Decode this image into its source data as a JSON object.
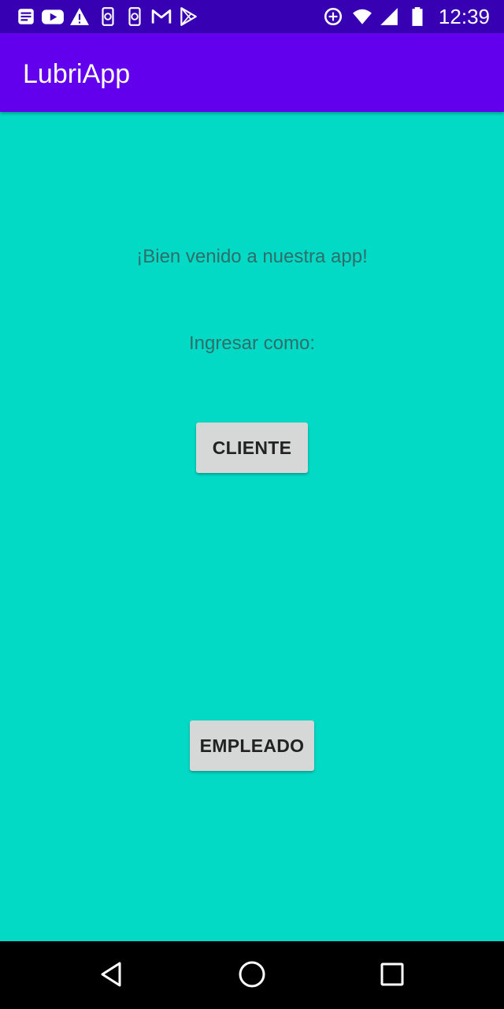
{
  "status_bar": {
    "time": "12:39",
    "left_icons": [
      "notes-icon",
      "youtube-icon",
      "warning-icon",
      "phone-sync-icon",
      "phone-sync-icon",
      "gmail-icon",
      "play-store-icon"
    ],
    "right_icons": [
      "data-saver-icon",
      "wifi-icon",
      "signal-icon",
      "battery-icon"
    ],
    "background": "#3700B3"
  },
  "app_bar": {
    "title": "LubriApp",
    "background": "#6200EE"
  },
  "main": {
    "background": "#03DAC5",
    "welcome_text": "¡Bien venido a nuestra app!",
    "login_as_text": "Ingresar como:",
    "cliente_label": "CLIENTE",
    "empleado_label": "EMPLEADO"
  },
  "nav_bar": {
    "buttons": [
      "back-icon",
      "home-icon",
      "recents-icon"
    ]
  }
}
